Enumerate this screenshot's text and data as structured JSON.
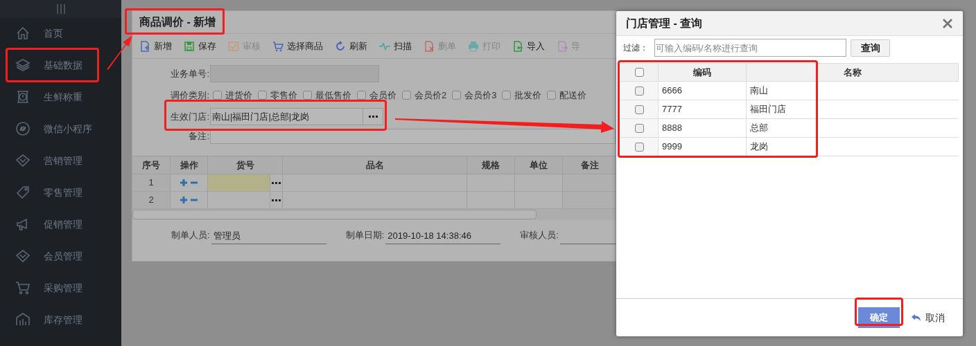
{
  "sidebar": {
    "items": [
      {
        "label": "首页"
      },
      {
        "label": "基础数据"
      },
      {
        "label": "生鲜称重"
      },
      {
        "label": "微信小程序"
      },
      {
        "label": "营销管理"
      },
      {
        "label": "零售管理"
      },
      {
        "label": "促销管理"
      },
      {
        "label": "会员管理"
      },
      {
        "label": "采购管理"
      },
      {
        "label": "库存管理"
      }
    ]
  },
  "price_adjustment": {
    "title": "商品调价 - 新增",
    "toolbar": [
      {
        "label": "新增",
        "disabled": false
      },
      {
        "label": "保存",
        "disabled": false
      },
      {
        "label": "审核",
        "disabled": true
      },
      {
        "label": "选择商品",
        "disabled": false
      },
      {
        "label": "刷新",
        "disabled": false
      },
      {
        "label": "扫描",
        "disabled": false
      },
      {
        "label": "删单",
        "disabled": true
      },
      {
        "label": "打印",
        "disabled": true
      },
      {
        "label": "导入",
        "disabled": false
      },
      {
        "label": "导",
        "disabled": true
      }
    ],
    "order_number": {
      "label": "业务单号:"
    },
    "price_types": {
      "label": "调价类别:",
      "options": [
        {
          "label": "进货价",
          "checked": false
        },
        {
          "label": "零售价",
          "checked": false
        },
        {
          "label": "最低售价",
          "checked": false
        },
        {
          "label": "会员价",
          "checked": false
        },
        {
          "label": "会员价2",
          "checked": false
        },
        {
          "label": "会员价3",
          "checked": false
        },
        {
          "label": "批发价",
          "checked": false
        },
        {
          "label": "配送价",
          "checked": false
        }
      ]
    },
    "stores": {
      "label": "生效门店:",
      "value": "南山|福田门店|总部|龙岗"
    },
    "remark": {
      "label": "备注:"
    },
    "grid": {
      "columns": [
        "序号",
        "操作",
        "货号",
        "品名",
        "规格",
        "单位",
        "备注"
      ],
      "rows": [
        {
          "index": "1",
          "selected": true
        },
        {
          "index": "2",
          "selected": false
        }
      ]
    },
    "footer": [
      {
        "label": "制单人员:",
        "value": "管理员"
      },
      {
        "label": "制单日期:",
        "value": "2019-10-18 14:38:46"
      },
      {
        "label": "审核人员:"
      }
    ]
  },
  "dialog": {
    "title": "门店管理 - 查询",
    "filter": {
      "label": "过滤：",
      "placeholder": "可输入编码/名称进行查询",
      "button": "查询"
    },
    "table": {
      "columns": [
        "编码",
        "名称"
      ],
      "all_checked": false,
      "rows": [
        {
          "code": "6666",
          "name": "南山",
          "checked": false
        },
        {
          "code": "7777",
          "name": "福田门店",
          "checked": false
        },
        {
          "code": "8888",
          "name": "总部",
          "checked": false
        },
        {
          "code": "9999",
          "name": "龙岗",
          "checked": false
        }
      ]
    },
    "confirm": "确定",
    "cancel": "取消"
  }
}
